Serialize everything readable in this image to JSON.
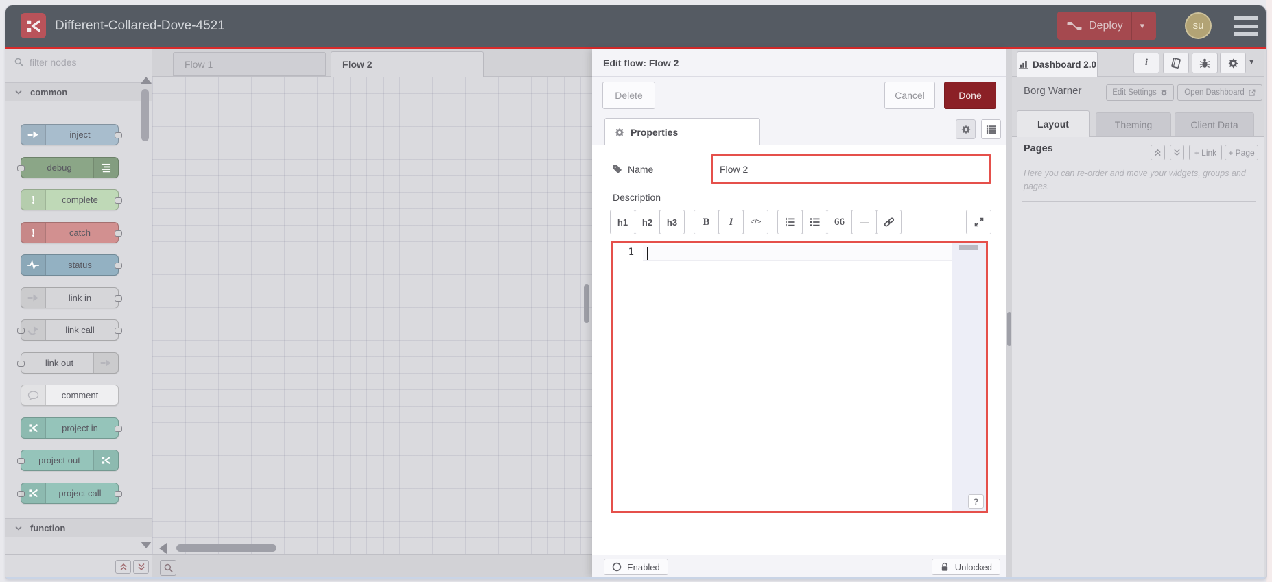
{
  "header": {
    "title": "Different-Collared-Dove-4521",
    "deploy_label": "Deploy",
    "avatar_initials": "su"
  },
  "palette": {
    "filter_placeholder": "filter nodes",
    "categories": [
      {
        "label": "common"
      },
      {
        "label": "function"
      }
    ],
    "nodes": [
      {
        "label": "inject"
      },
      {
        "label": "debug"
      },
      {
        "label": "complete"
      },
      {
        "label": "catch"
      },
      {
        "label": "status"
      },
      {
        "label": "link in"
      },
      {
        "label": "link call"
      },
      {
        "label": "link out"
      },
      {
        "label": "comment"
      },
      {
        "label": "project in"
      },
      {
        "label": "project out"
      },
      {
        "label": "project call"
      }
    ],
    "exclamation": "!"
  },
  "workspace": {
    "tabs": [
      {
        "label": "Flow 1",
        "active": false
      },
      {
        "label": "Flow 2",
        "active": true
      }
    ]
  },
  "edit_dialog": {
    "title": "Edit flow: Flow 2",
    "delete_label": "Delete",
    "cancel_label": "Cancel",
    "done_label": "Done",
    "properties_tab": "Properties",
    "name_label": "Name",
    "name_value": "Flow 2",
    "description_label": "Description",
    "toolbar": {
      "h1": "h1",
      "h2": "h2",
      "h3": "h3",
      "bold": "B",
      "italic": "I",
      "code": "</>",
      "quote": "66",
      "hr": "—"
    },
    "editor": {
      "line_number": "1"
    },
    "help_button": "?",
    "enabled_label": "Enabled",
    "locked_label": "Unlocked"
  },
  "sidebar": {
    "tab_label": "Dashboard 2.0",
    "project_name": "Borg Warner",
    "edit_settings_label": "Edit Settings",
    "open_dashboard_label": "Open Dashboard",
    "tabs": [
      {
        "label": "Layout"
      },
      {
        "label": "Theming"
      },
      {
        "label": "Client Data"
      }
    ],
    "pages": {
      "title": "Pages",
      "add_link_label": "+ Link",
      "add_page_label": "+ Page",
      "help_text": "Here you can re-order and move your widgets, groups and pages."
    }
  },
  "icons": {
    "caret_down": "▾"
  },
  "colors": {
    "accent_red": "#d92b2b",
    "highlight_border": "#e5504b",
    "done_button": "#8b2026",
    "deploy_button": "#a5494f",
    "header_bg": "#555b63",
    "avatar_bg": "#b2a375",
    "node_inject": "#a8bdcd",
    "node_debug": "#8ba687",
    "node_complete": "#bfd9b7",
    "node_catch": "#d29090",
    "node_status": "#93b1c2",
    "node_link": "#d6d6d9",
    "node_comment": "#efeff1",
    "node_project": "#95c4ba"
  }
}
